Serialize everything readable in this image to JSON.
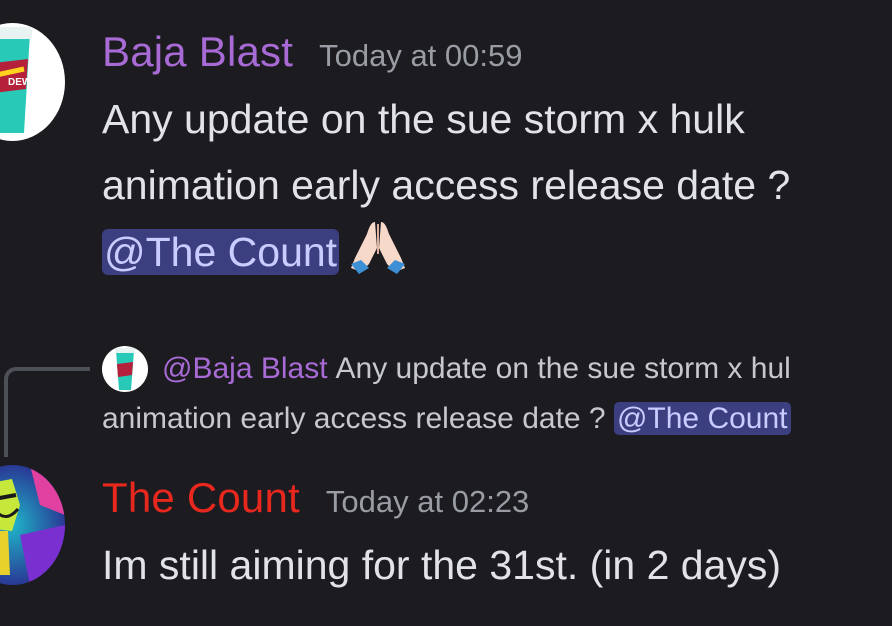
{
  "messages": [
    {
      "author": "Baja Blast",
      "author_color": "#a86bd6",
      "avatar_icon": "soda-cup-avatar",
      "timestamp": "Today at 00:59",
      "lines": [
        "Any update on the sue storm x hulk",
        "animation early access release date ?"
      ],
      "mention": "@The Count",
      "emoji": "folded-hands-emoji"
    },
    {
      "author": "The Count",
      "author_color": "#e8281e",
      "avatar_icon": "villain-character-avatar",
      "timestamp": "Today at 02:23",
      "text": "Im still aiming for the 31st. (in 2 days)"
    }
  ],
  "reply": {
    "author": "@Baja Blast",
    "line1": "Any update on the sue storm x hul",
    "line2": "animation early access release date ?",
    "mention": "@The Count",
    "mention_bg": "#3b3f80"
  }
}
